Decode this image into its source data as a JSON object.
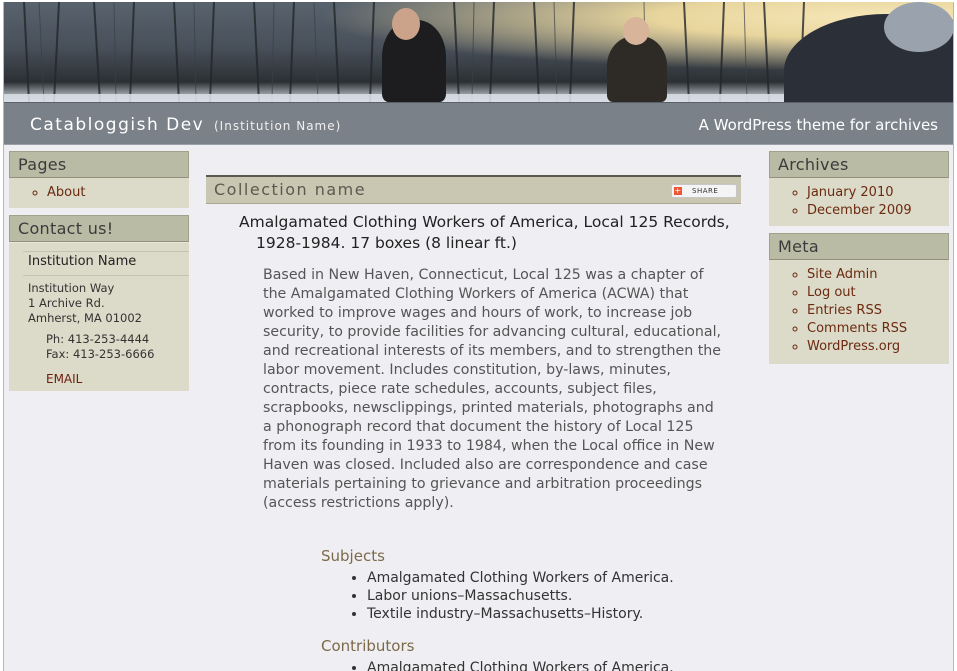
{
  "header": {
    "site_title": "Catabloggish Dev",
    "institution_sub": "(Institution Name)",
    "tagline": "A WordPress theme for archives"
  },
  "sidebar_left": {
    "pages": {
      "heading": "Pages",
      "items": [
        "About"
      ]
    },
    "contact": {
      "heading": "Contact us!",
      "institution_name": "Institution Name",
      "address_line1": "Institution Way",
      "address_line2": "1 Archive Rd.",
      "address_line3": "Amherst, MA 01002",
      "phone": "Ph: 413-253-4444",
      "fax": "Fax: 413-253-6666",
      "email_label": "EMAIL"
    }
  },
  "main": {
    "collection_heading": "Collection name",
    "share_label": "SHARE",
    "record_title": "Amalgamated Clothing Workers of America, Local 125 Records, 1928-1984. 17 boxes (8 linear ft.)",
    "description": "Based in New Haven, Connecticut, Local 125 was a chapter of the Amalgamated Clothing Workers of America (ACWA) that worked to improve wages and hours of work, to increase job security, to provide facilities for advancing cultural, educational, and recreational interests of its members, and to strengthen the labor movement. Includes constitution, by-laws, minutes, contracts, piece rate schedules, accounts, subject files, scrapbooks, newsclippings, printed materials, photographs and a phonograph record that document the history of Local 125 from its founding in 1933 to 1984, when the Local office in New Haven was closed. Included also are correspondence and case materials pertaining to grievance and arbitration proceedings (access restrictions apply).",
    "subjects_heading": "Subjects",
    "subjects": [
      "Amalgamated Clothing Workers of America.",
      "Labor unions–Massachusetts.",
      "Textile industry–Massachusetts–History."
    ],
    "contributors_heading": "Contributors",
    "contributors": [
      "Amalgamated Clothing Workers of America."
    ]
  },
  "sidebar_right": {
    "archives": {
      "heading": "Archives",
      "items": [
        "January 2010",
        "December 2009"
      ]
    },
    "meta": {
      "heading": "Meta",
      "items": [
        "Site Admin",
        "Log out",
        "Entries RSS",
        "Comments RSS",
        "WordPress.org"
      ]
    }
  },
  "colors": {
    "page_bg": "#efeef3",
    "title_bar": "#7a8189",
    "widget_head": "#b9bba5",
    "widget_body": "#dcdac8",
    "link": "#6b2a10"
  }
}
